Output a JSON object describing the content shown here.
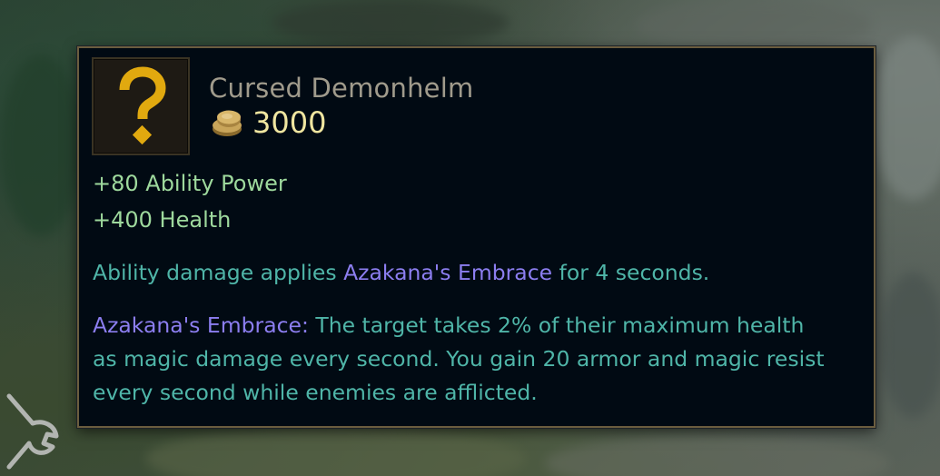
{
  "item": {
    "name": "Cursed Demonhelm",
    "icon": "question-mark-icon",
    "cost": "3000",
    "cost_icon": "gold-coins-icon"
  },
  "stats": [
    "+80 Ability Power",
    "+400 Health"
  ],
  "passive": {
    "prefix": "Ability damage applies ",
    "keyword": "Azakana's Embrace",
    "suffix": " for 4 seconds."
  },
  "effect": {
    "keyword": "Azakana's Embrace:",
    "line1": " The target takes 2% of their maximum health",
    "line2": "as magic damage every second. You gain 20 armor and magic resist",
    "line3": "every second while enemies are afflicted."
  },
  "colors": {
    "tooltip_bg": "#010a13",
    "border": "#6b5d3f",
    "name": "#a09b8c",
    "cost": "#f0e6a0",
    "stat": "#9ed99d",
    "description": "#4fb5a8",
    "keyword": "#8c7ef0",
    "icon_glyph": "#e1a90f"
  }
}
